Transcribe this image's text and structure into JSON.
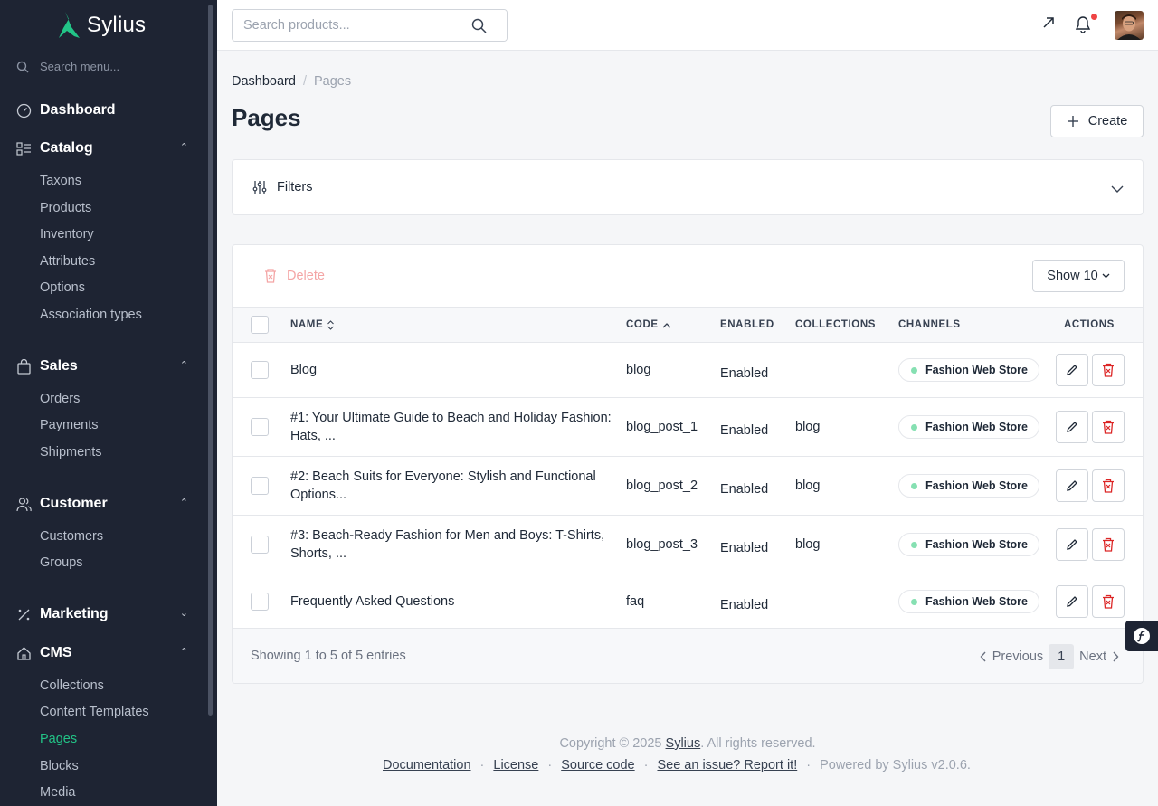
{
  "brand": {
    "name": "Sylius",
    "accent": "#22c487"
  },
  "sidebar": {
    "search_placeholder": "Search menu...",
    "dashboard": "Dashboard",
    "catalog": {
      "label": "Catalog",
      "items": [
        "Taxons",
        "Products",
        "Inventory",
        "Attributes",
        "Options",
        "Association types"
      ]
    },
    "sales": {
      "label": "Sales",
      "items": [
        "Orders",
        "Payments",
        "Shipments"
      ]
    },
    "customer": {
      "label": "Customer",
      "items": [
        "Customers",
        "Groups"
      ]
    },
    "marketing": {
      "label": "Marketing"
    },
    "cms": {
      "label": "CMS",
      "items": [
        "Collections",
        "Content Templates",
        "Pages",
        "Blocks",
        "Media"
      ],
      "active": "Pages"
    }
  },
  "topbar": {
    "search_placeholder": "Search products..."
  },
  "breadcrumb": {
    "home": "Dashboard",
    "sep": "/",
    "current": "Pages"
  },
  "page": {
    "title": "Pages",
    "create_label": "Create"
  },
  "filters": {
    "label": "Filters"
  },
  "toolbar": {
    "delete_label": "Delete",
    "show_label": "Show 10"
  },
  "table": {
    "headers": {
      "name": "NAME",
      "code": "CODE",
      "enabled": "ENABLED",
      "collections": "COLLECTIONS",
      "channels": "CHANNELS",
      "actions": "ACTIONS"
    },
    "rows": [
      {
        "name": "Blog",
        "code": "blog",
        "enabled": "Enabled",
        "collections": "",
        "channel": "Fashion Web Store"
      },
      {
        "name": "#1: Your Ultimate Guide to Beach and Holiday Fashion: Hats, ...",
        "code": "blog_post_1",
        "enabled": "Enabled",
        "collections": "blog",
        "channel": "Fashion Web Store"
      },
      {
        "name": "#2: Beach Suits for Everyone: Stylish and Functional Options...",
        "code": "blog_post_2",
        "enabled": "Enabled",
        "collections": "blog",
        "channel": "Fashion Web Store"
      },
      {
        "name": "#3: Beach-Ready Fashion for Men and Boys: T-Shirts, Shorts, ...",
        "code": "blog_post_3",
        "enabled": "Enabled",
        "collections": "blog",
        "channel": "Fashion Web Store"
      },
      {
        "name": "Frequently Asked Questions",
        "code": "faq",
        "enabled": "Enabled",
        "collections": "",
        "channel": "Fashion Web Store"
      }
    ]
  },
  "pagination": {
    "info": "Showing 1 to 5 of 5 entries",
    "previous": "Previous",
    "page": "1",
    "next": "Next"
  },
  "footer": {
    "copyright_prefix": "Copyright © 2025",
    "copyright_link": "Sylius",
    "copyright_suffix": ". All rights reserved.",
    "links": [
      "Documentation",
      "License",
      "Source code",
      "See an issue? Report it!"
    ],
    "dot": "·",
    "powered": "Powered by Sylius v2.0.6."
  }
}
